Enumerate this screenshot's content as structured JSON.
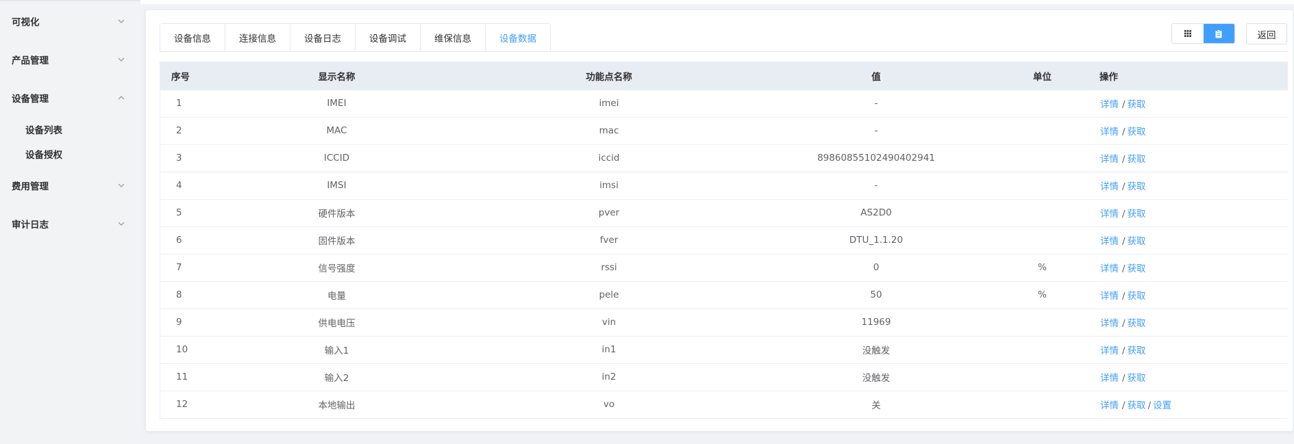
{
  "sidebar": {
    "groups": [
      {
        "label": "可视化",
        "expanded": false
      },
      {
        "label": "产品管理",
        "expanded": false
      },
      {
        "label": "设备管理",
        "expanded": true,
        "children": [
          "设备列表",
          "设备授权"
        ]
      },
      {
        "label": "费用管理",
        "expanded": false
      },
      {
        "label": "审计日志",
        "expanded": false
      }
    ]
  },
  "tabs": [
    "设备信息",
    "连接信息",
    "设备日志",
    "设备调试",
    "维保信息",
    "设备数据"
  ],
  "active_tab": "设备数据",
  "toolbar": {
    "grid_icon": "grid-icon",
    "list_icon": "clipboard-icon",
    "back_label": "返回"
  },
  "table": {
    "headers": [
      "序号",
      "显示名称",
      "功能点名称",
      "值",
      "单位",
      "操作"
    ],
    "ops": {
      "detail": "详情",
      "fetch": "获取",
      "set": "设置",
      "sep": "/"
    },
    "rows": [
      {
        "no": "1",
        "name": "IMEI",
        "func": "imei",
        "value": "-",
        "unit": "",
        "set": false
      },
      {
        "no": "2",
        "name": "MAC",
        "func": "mac",
        "value": "-",
        "unit": "",
        "set": false
      },
      {
        "no": "3",
        "name": "ICCID",
        "func": "iccid",
        "value": "89860855102490402941",
        "unit": "",
        "set": false
      },
      {
        "no": "4",
        "name": "IMSI",
        "func": "imsi",
        "value": "-",
        "unit": "",
        "set": false
      },
      {
        "no": "5",
        "name": "硬件版本",
        "func": "pver",
        "value": "AS2D0",
        "unit": "",
        "set": false
      },
      {
        "no": "6",
        "name": "固件版本",
        "func": "fver",
        "value": "DTU_1.1.20",
        "unit": "",
        "set": false
      },
      {
        "no": "7",
        "name": "信号强度",
        "func": "rssi",
        "value": "0",
        "unit": "%",
        "set": false
      },
      {
        "no": "8",
        "name": "电量",
        "func": "pele",
        "value": "50",
        "unit": "%",
        "set": false
      },
      {
        "no": "9",
        "name": "供电电压",
        "func": "vin",
        "value": "11969",
        "unit": "",
        "set": false
      },
      {
        "no": "10",
        "name": "输入1",
        "func": "in1",
        "value": "没触发",
        "unit": "",
        "set": false
      },
      {
        "no": "11",
        "name": "输入2",
        "func": "in2",
        "value": "没触发",
        "unit": "",
        "set": false
      },
      {
        "no": "12",
        "name": "本地输出",
        "func": "vo",
        "value": "关",
        "unit": "",
        "set": true
      }
    ]
  },
  "colors": {
    "accent": "#409eff",
    "header_bg": "#e8ecf3",
    "sidebar_bg": "#f2f3f5"
  }
}
